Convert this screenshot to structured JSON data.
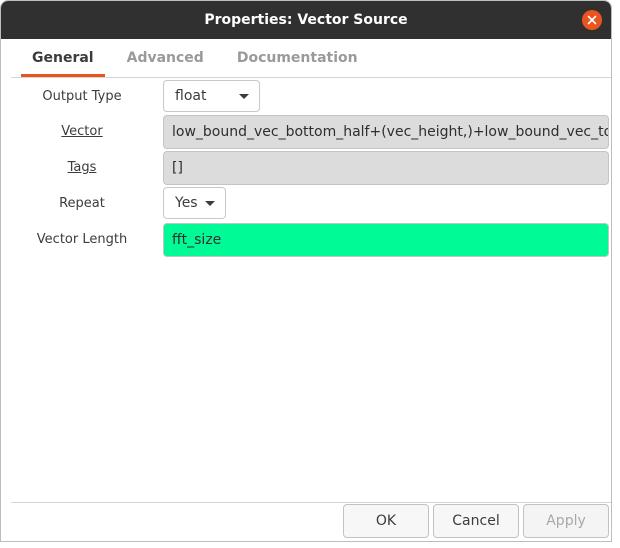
{
  "window": {
    "title": "Properties: Vector Source"
  },
  "tabs": [
    {
      "label": "General",
      "active": true
    },
    {
      "label": "Advanced",
      "active": false
    },
    {
      "label": "Documentation",
      "active": false
    }
  ],
  "fields": {
    "output_type": {
      "label": "Output Type",
      "value": "float"
    },
    "vector": {
      "label": "Vector",
      "value": "low_bound_vec_bottom_half+(vec_height,)+low_bound_vec_top"
    },
    "tags": {
      "label": "Tags",
      "value": "[]"
    },
    "repeat": {
      "label": "Repeat",
      "value": "Yes"
    },
    "vector_length": {
      "label": "Vector Length",
      "value": "fft_size"
    }
  },
  "buttons": {
    "ok": "OK",
    "cancel": "Cancel",
    "apply": "Apply"
  },
  "colors": {
    "accent": "#e95420",
    "titlebar": "#303030",
    "valid_field": "#00fa96",
    "readonly_field": "#dcdcdc"
  },
  "icons": {
    "close": "close-icon",
    "dropdown": "chevron-down-icon"
  }
}
